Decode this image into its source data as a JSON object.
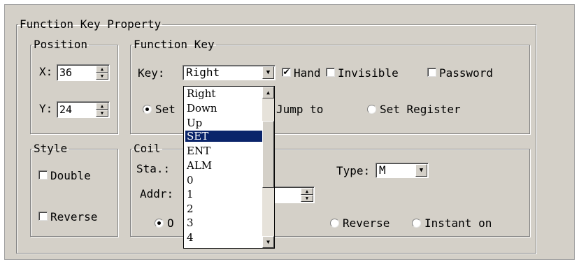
{
  "property_group": {
    "title": "Function Key Property"
  },
  "position": {
    "title": "Position",
    "x_label": "X:",
    "x_value": "36",
    "y_label": "Y:",
    "y_value": "24"
  },
  "function_key": {
    "title": "Function Key",
    "key_label": "Key:",
    "key_value": "Right",
    "hand_label": "Hand",
    "hand_checked": true,
    "invisible_label": "Invisible",
    "invisible_checked": false,
    "password_label": "Password",
    "password_checked": false,
    "modes": [
      {
        "label": "Set",
        "selected": true
      },
      {
        "label": "Jump to",
        "selected": false
      },
      {
        "label": "Set Register",
        "selected": false
      }
    ]
  },
  "style": {
    "title": "Style",
    "double_label": "Double",
    "double_checked": false,
    "reverse_label": "Reverse",
    "reverse_checked": false
  },
  "coil": {
    "title": "Coil",
    "station_label": "Sta.:",
    "type_label": "Type:",
    "type_value": "M",
    "addr_label": "Addr:",
    "actions": [
      {
        "label": "O",
        "selected": true
      },
      {
        "label": "Reverse",
        "selected": false
      },
      {
        "label": "Instant on",
        "selected": false
      }
    ]
  },
  "key_dropdown": {
    "options": [
      "Right",
      "Down",
      "Up",
      "SET",
      "ENT",
      "ALM",
      "0",
      "1",
      "2",
      "3",
      "4"
    ],
    "selected": "SET"
  },
  "icons": {
    "checkmark": "check-icon",
    "dropdown": "down-triangle-icon",
    "spin_up": "up-triangle-icon",
    "spin_down": "down-triangle-icon"
  },
  "colors": {
    "dialog_bg": "#d4d0c8",
    "selection_bg": "#0a246a"
  }
}
